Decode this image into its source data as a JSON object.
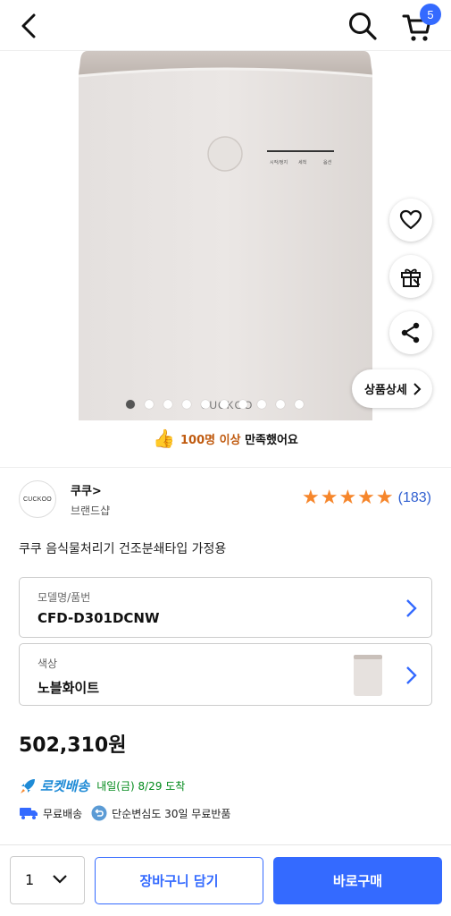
{
  "header": {
    "back_icon": "back-arrow-icon",
    "search_icon": "search-icon",
    "cart_icon": "cart-icon",
    "cart_count": "5"
  },
  "hero": {
    "image_logo": "CUCKOO",
    "panel_labels": [
      "시작/정지",
      "세척",
      "옵션"
    ],
    "side_actions": [
      {
        "icon": "heart-icon"
      },
      {
        "icon": "gift-icon"
      },
      {
        "icon": "share-icon"
      }
    ],
    "detail_button_label": "상품상세",
    "carousel_total": 10,
    "carousel_active": 1
  },
  "satisfaction": {
    "emoji": "👍",
    "count_text": "100명 이상",
    "suffix_text": "만족했어요"
  },
  "brand": {
    "logo_text": "CUCKOO",
    "name": "쿠쿠",
    "chevron": ">",
    "shop_label": "브랜드샵",
    "rating_stars": 5,
    "review_count": "(183)"
  },
  "product": {
    "title": "쿠쿠 음식물처리기 건조분쇄타입 가정용"
  },
  "options": {
    "model": {
      "label": "모델명/품번",
      "value": "CFD-D301DCNW"
    },
    "color": {
      "label": "색상",
      "value": "노블화이트"
    }
  },
  "price": "502,310원",
  "shipping": {
    "rocket_label": "로켓배송",
    "eta": "내일(금) 8/29 도착",
    "free_shipping": "무료배송",
    "free_return": "단순변심도 30일 무료반품"
  },
  "bottom": {
    "quantity": "1",
    "add_to_cart": "장바구니 담기",
    "buy_now": "바로구매"
  },
  "colors": {
    "accent": "#346aff",
    "star": "#f6862b",
    "rocket": "#1f8bd6",
    "eta_green": "#00891a",
    "satisfaction_orange": "#c05b10"
  }
}
